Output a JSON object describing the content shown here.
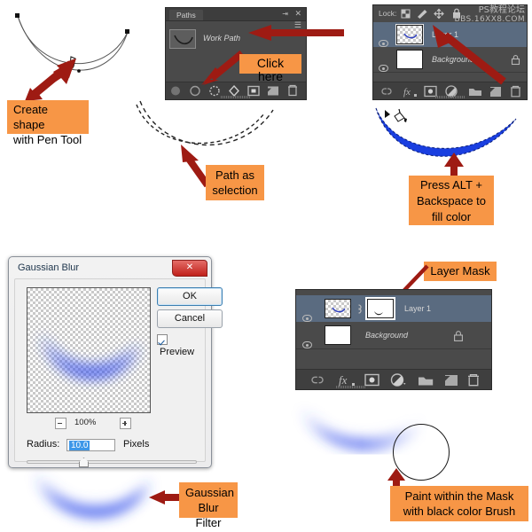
{
  "meta": {
    "tutorial_topic": "Photoshop curved glow shape tutorial",
    "accent_callout_bg": "#F79646",
    "arrow_color": "#9E1B13",
    "shape_fill_blue": "#1A3FE0"
  },
  "watermark": {
    "line1": "PS教程论坛",
    "line2": "BBS.16XX8.COM"
  },
  "callouts": {
    "create_shape": "Create shape\nwith Pen Tool",
    "click_here": "Click here",
    "path_as_selection": "Path as\nselection",
    "press_alt": "Press ALT +\nBackspace to\nfill color",
    "layer_mask": "Layer Mask",
    "gaussian_blur_filter": "Gaussian\nBlur Filter",
    "paint_within_mask": "Paint within the Mask\nwith black color Brush"
  },
  "paths_panel": {
    "tab_label": "Paths",
    "path_name": "Work Path",
    "footer_icons": [
      "fill-path-icon",
      "stroke-path-icon",
      "load-path-as-selection-icon",
      "make-work-path-icon",
      "add-layer-mask-icon",
      "new-path-icon",
      "delete-path-icon"
    ],
    "titlebar_icons": [
      "collapse-icon",
      "close-icon",
      "panel-menu-icon"
    ]
  },
  "layers_panel_top": {
    "lock_label": "Lock:",
    "lock_icons": [
      "lock-transparent-pixels-icon",
      "lock-image-pixels-icon",
      "lock-position-icon",
      "lock-all-icon"
    ],
    "rows": [
      {
        "name": "Layer 1",
        "visible": true,
        "locked": false,
        "selected": true,
        "thumb": "transparent"
      },
      {
        "name": "Background",
        "visible": true,
        "locked": true,
        "selected": false,
        "thumb": "white"
      }
    ],
    "footer_icons": [
      "link-layers-icon",
      "layer-style-fx-icon",
      "add-layer-mask-icon",
      "adjustment-layer-icon",
      "new-group-icon",
      "new-layer-icon",
      "delete-layer-icon"
    ]
  },
  "layers_panel_bottom": {
    "rows": [
      {
        "name": "Layer 1",
        "visible": true,
        "locked": false,
        "selected": true,
        "thumb": "transparent",
        "has_mask": true,
        "mask_linked": true
      },
      {
        "name": "Background",
        "visible": true,
        "locked": true,
        "selected": false,
        "thumb": "white",
        "has_mask": false
      }
    ],
    "footer_icons": [
      "link-layers-icon",
      "layer-style-fx-icon",
      "add-layer-mask-icon",
      "adjustment-layer-icon",
      "new-group-icon",
      "new-layer-icon",
      "delete-layer-icon"
    ]
  },
  "gaussian_blur_dialog": {
    "title": "Gaussian Blur",
    "close_label": "✕",
    "ok_label": "OK",
    "cancel_label": "Cancel",
    "preview_label": "Preview",
    "preview_checked": true,
    "zoom_level": "100%",
    "zoom_out_icon": "minus-icon",
    "zoom_in_icon": "plus-icon",
    "radius_label": "Radius:",
    "radius_value": "10.0",
    "radius_unit": "Pixels",
    "slider_position_percent": 38
  },
  "canvas_items": {
    "pen_path_label": "pen-path-preview",
    "marching_ants_label": "selection-marching-ants",
    "filled_shape_label": "blue-filled-curve",
    "blurred_shape_label": "blurred-blue-curve",
    "masked_shape_label": "masked-blurred-curve",
    "brush_cursor_label": "brush-circle-cursor"
  }
}
